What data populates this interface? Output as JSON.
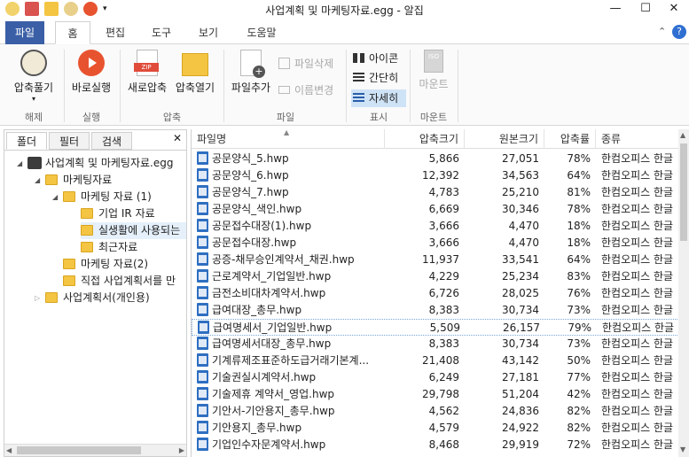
{
  "window": {
    "title": "사업계획 및 마케팅자료.egg - 알집",
    "minimize": "—",
    "maximize": "☐",
    "close": "✕"
  },
  "menu_tabs": [
    {
      "label": "파일"
    },
    {
      "label": "홈"
    },
    {
      "label": "편집"
    },
    {
      "label": "도구"
    },
    {
      "label": "보기"
    },
    {
      "label": "도움말"
    }
  ],
  "ribbon": {
    "unzip": "압축풀기",
    "run": "바로실행",
    "new_zip": "새로압축",
    "open_zip": "압축열기",
    "add_file": "파일추가",
    "delete_file": "파일삭제",
    "rename": "이름변경",
    "icon_view": "아이콘",
    "simple_view": "간단히",
    "detail_view": "자세히",
    "mount": "마운트",
    "groups": {
      "unzip": "해제",
      "run": "실행",
      "zip": "압축",
      "file": "파일",
      "view": "표시",
      "mount": "마운트"
    }
  },
  "left_tabs": [
    {
      "label": "폴더"
    },
    {
      "label": "필터"
    },
    {
      "label": "검색"
    }
  ],
  "tree": [
    {
      "label": "사업계획 및 마케팅자료.egg"
    },
    {
      "label": "마케팅자료"
    },
    {
      "label": "마케팅 자료 (1)"
    },
    {
      "label": "기업 IR 자료"
    },
    {
      "label": "실생활에 사용되는"
    },
    {
      "label": "최근자료"
    },
    {
      "label": "마케팅 자료(2)"
    },
    {
      "label": "직접 사업계획서를 만"
    },
    {
      "label": "사업계획서(개인용)"
    }
  ],
  "columns": {
    "name": "파일명",
    "packed": "압축크기",
    "original": "원본크기",
    "ratio": "압축률",
    "type": "종류"
  },
  "files": [
    {
      "name": "공문양식_5.hwp",
      "packed": "5,866",
      "original": "27,051",
      "ratio": "78%",
      "type": "한컴오피스 한글"
    },
    {
      "name": "공문양식_6.hwp",
      "packed": "12,392",
      "original": "34,563",
      "ratio": "64%",
      "type": "한컴오피스 한글"
    },
    {
      "name": "공문양식_7.hwp",
      "packed": "4,783",
      "original": "25,210",
      "ratio": "81%",
      "type": "한컴오피스 한글"
    },
    {
      "name": "공문양식_색인.hwp",
      "packed": "6,669",
      "original": "30,346",
      "ratio": "78%",
      "type": "한컴오피스 한글"
    },
    {
      "name": "공문접수대장(1).hwp",
      "packed": "3,666",
      "original": "4,470",
      "ratio": "18%",
      "type": "한컴오피스 한글"
    },
    {
      "name": "공문접수대장.hwp",
      "packed": "3,666",
      "original": "4,470",
      "ratio": "18%",
      "type": "한컴오피스 한글"
    },
    {
      "name": "공증-채무승인계약서_채권.hwp",
      "packed": "11,937",
      "original": "33,541",
      "ratio": "64%",
      "type": "한컴오피스 한글"
    },
    {
      "name": "근로계약서_기업일반.hwp",
      "packed": "4,229",
      "original": "25,234",
      "ratio": "83%",
      "type": "한컴오피스 한글"
    },
    {
      "name": "금전소비대차계약서.hwp",
      "packed": "6,726",
      "original": "28,025",
      "ratio": "76%",
      "type": "한컴오피스 한글"
    },
    {
      "name": "급여대장_총무.hwp",
      "packed": "8,383",
      "original": "30,734",
      "ratio": "73%",
      "type": "한컴오피스 한글"
    },
    {
      "name": "급여명세서_기업일반.hwp",
      "packed": "5,509",
      "original": "26,157",
      "ratio": "79%",
      "type": "한컴오피스 한글"
    },
    {
      "name": "급여명세서대장_총무.hwp",
      "packed": "8,383",
      "original": "30,734",
      "ratio": "73%",
      "type": "한컴오피스 한글"
    },
    {
      "name": "기계류제조표준하도급거래기본계...",
      "packed": "21,408",
      "original": "43,142",
      "ratio": "50%",
      "type": "한컴오피스 한글"
    },
    {
      "name": "기술권실시계약서.hwp",
      "packed": "6,249",
      "original": "27,181",
      "ratio": "77%",
      "type": "한컴오피스 한글"
    },
    {
      "name": "기술제휴 계약서_영업.hwp",
      "packed": "29,798",
      "original": "51,204",
      "ratio": "42%",
      "type": "한컴오피스 한글"
    },
    {
      "name": "기안서-기안용지_총무.hwp",
      "packed": "4,562",
      "original": "24,836",
      "ratio": "82%",
      "type": "한컴오피스 한글"
    },
    {
      "name": "기안용지_총무.hwp",
      "packed": "4,579",
      "original": "24,922",
      "ratio": "82%",
      "type": "한컴오피스 한글"
    },
    {
      "name": "기업인수자문계약서.hwp",
      "packed": "8,468",
      "original": "29,919",
      "ratio": "72%",
      "type": "한컴오피스 한글"
    }
  ],
  "colors": {
    "file_tab": "#3a5fa6",
    "selection": "#cfe3f7",
    "folder": "#f4c542"
  }
}
